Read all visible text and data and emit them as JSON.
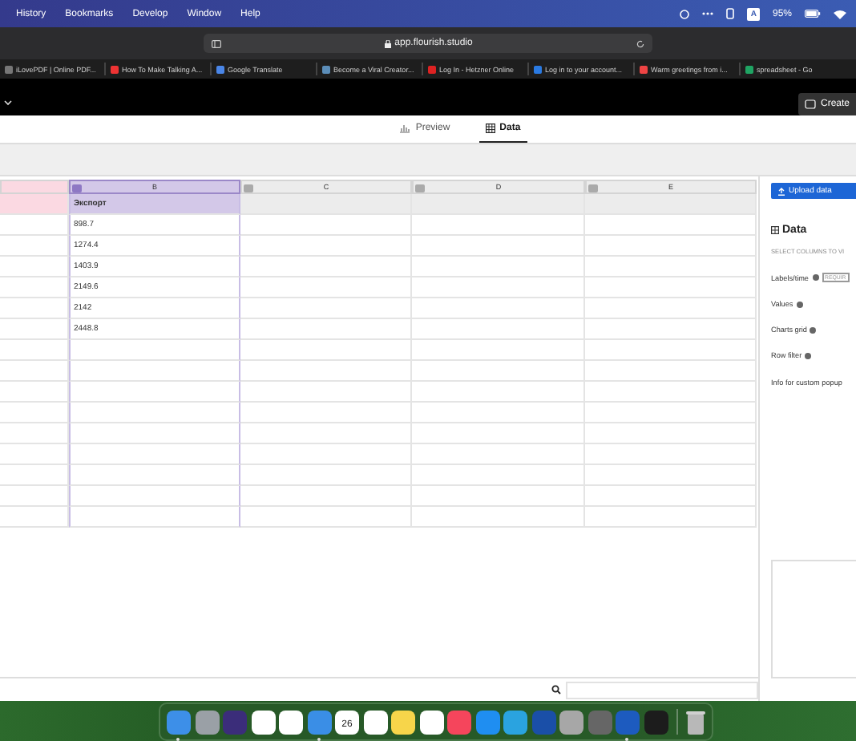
{
  "menu_bar": {
    "items": [
      "History",
      "Bookmarks",
      "Develop",
      "Window",
      "Help"
    ],
    "input_source": "A",
    "battery": "95%"
  },
  "address_bar": {
    "url": "app.flourish.studio"
  },
  "bookmarks": [
    {
      "label": "iLovePDF | Online PDF..."
    },
    {
      "label": "How To Make Talking A..."
    },
    {
      "label": "Google Translate"
    },
    {
      "label": "Become a Viral Creator..."
    },
    {
      "label": "Log In - Hetzner Online"
    },
    {
      "label": "Log in to your account..."
    },
    {
      "label": "Warm greetings from i..."
    },
    {
      "label": "spreadsheet - Go"
    }
  ],
  "app_header": {
    "create_button": "Create"
  },
  "view_tabs": [
    {
      "label": "Preview",
      "kind": "chart",
      "selected": false
    },
    {
      "label": "Data",
      "kind": "table",
      "selected": true
    }
  ],
  "grid": {
    "columns": [
      {
        "letter": "B",
        "selected": true
      },
      {
        "letter": "C",
        "selected": false
      },
      {
        "letter": "D",
        "selected": false
      },
      {
        "letter": "E",
        "selected": false
      }
    ],
    "column_b_cells": [
      "Экспорт",
      "898.7",
      "1274.4",
      "1403.9",
      "2149.6",
      "2142",
      "2448.8"
    ]
  },
  "side_panel": {
    "upload_button": "Upload data",
    "heading": "Data",
    "section_label": "SELECT COLUMNS TO VI",
    "required_tag": "REQUIR",
    "fields": [
      {
        "label": "Labels/time",
        "required": true
      },
      {
        "label": "Values",
        "required": false
      },
      {
        "label": "Charts grid",
        "required": false
      },
      {
        "label": "Row filter",
        "required": false
      }
    ],
    "note": "Info for custom popup"
  },
  "dock": {
    "calendar_day": "26"
  }
}
